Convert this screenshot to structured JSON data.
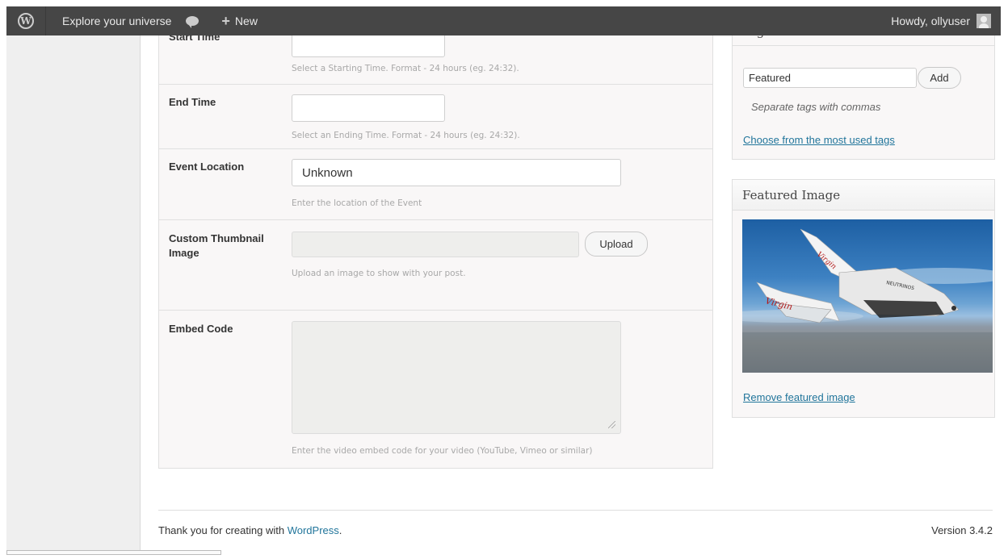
{
  "admin_bar": {
    "site_name": "Explore your universe",
    "new_label": "New",
    "greeting": "Howdy, ollyuser",
    "icons": [
      "wordpress-logo-icon",
      "comment-bubble-icon",
      "plus-icon",
      "user-avatar-icon"
    ]
  },
  "event_fields": {
    "start_time": {
      "label": "Start Time",
      "value": "",
      "description": "Select a Starting Time. Format - 24 hours (eg. 24:32)."
    },
    "end_time": {
      "label": "End Time",
      "value": "",
      "description": "Select an Ending Time. Format - 24 hours (eg. 24:32)."
    },
    "event_location": {
      "label": "Event Location",
      "value": "Unknown",
      "description": "Enter the location of the Event"
    },
    "custom_thumbnail": {
      "label": "Custom Thumbnail Image",
      "value": "",
      "button": "Upload",
      "description": "Upload an image to show with your post."
    },
    "embed_code": {
      "label": "Embed Code",
      "value": "",
      "description": "Enter the video embed code for your video (YouTube, Vimeo or similar)"
    }
  },
  "tags_box": {
    "title": "Tags",
    "input_value": "Featured",
    "add_button": "Add",
    "hint": "Separate tags with commas",
    "link": "Choose from the most used tags"
  },
  "featured_image_box": {
    "title": "Featured Image",
    "remove_link": "Remove featured image",
    "image_text": {
      "fuselage_logo": "Virgin",
      "tail_logo": "Virgin",
      "wing_text": "NEUTRINOS"
    }
  },
  "footer": {
    "thanks_prefix": "Thank you for creating with ",
    "wordpress_link": "WordPress",
    "thanks_suffix": ".",
    "version": "Version 3.4.2"
  },
  "colors": {
    "admin_bar": "#464646",
    "link": "#21759b",
    "box_background": "#f9f7f7"
  }
}
